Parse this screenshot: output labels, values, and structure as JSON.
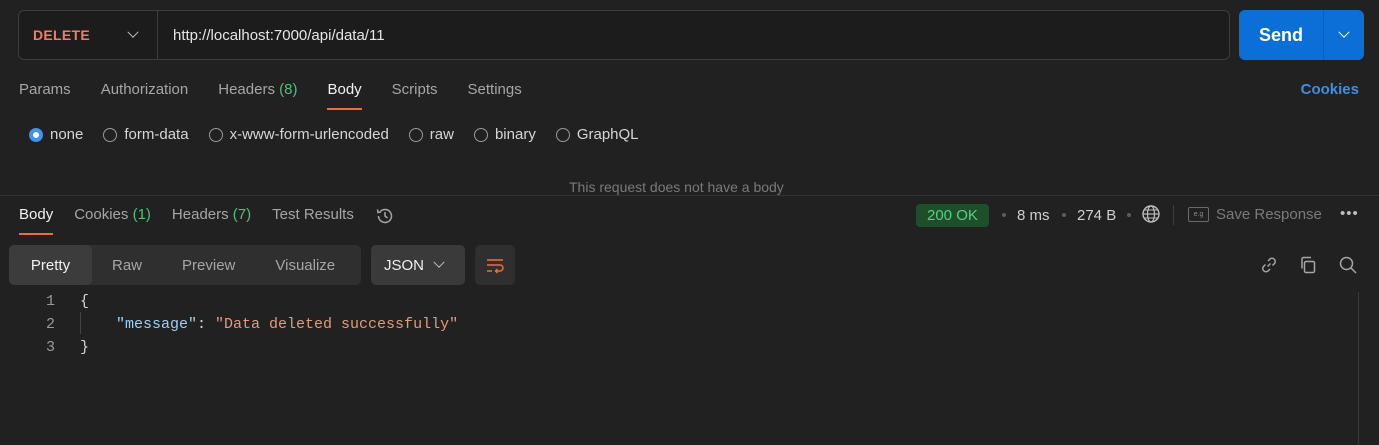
{
  "request": {
    "method": "DELETE",
    "url": "http://localhost:7000/api/data/11",
    "send_label": "Send"
  },
  "request_tabs": [
    {
      "label": "Params"
    },
    {
      "label": "Authorization"
    },
    {
      "label": "Headers",
      "count": "(8)"
    },
    {
      "label": "Body",
      "active": true
    },
    {
      "label": "Scripts"
    },
    {
      "label": "Settings"
    }
  ],
  "cookies_link": "Cookies",
  "body_options": [
    {
      "label": "none",
      "selected": true
    },
    {
      "label": "form-data"
    },
    {
      "label": "x-www-form-urlencoded"
    },
    {
      "label": "raw"
    },
    {
      "label": "binary"
    },
    {
      "label": "GraphQL"
    }
  ],
  "no_body_text": "This request does not have a body",
  "response_tabs": [
    {
      "label": "Body",
      "active": true
    },
    {
      "label": "Cookies",
      "count": "(1)"
    },
    {
      "label": "Headers",
      "count": "(7)"
    },
    {
      "label": "Test Results"
    }
  ],
  "response_meta": {
    "status": "200 OK",
    "time": "8 ms",
    "size": "274 B",
    "save_label": "Save Response",
    "save_icon_text": "e.g",
    "more": "•••"
  },
  "view_modes": [
    {
      "label": "Pretty",
      "active": true
    },
    {
      "label": "Raw"
    },
    {
      "label": "Preview"
    },
    {
      "label": "Visualize"
    }
  ],
  "format": "JSON",
  "code": {
    "line_numbers": [
      "1",
      "2",
      "3"
    ],
    "open_brace": "{",
    "key": "\"message\"",
    "colon": ": ",
    "value": "\"Data deleted successfully\"",
    "close_brace": "}"
  },
  "colors": {
    "accent": "#f26b3a",
    "send_button": "#0b6fd8",
    "method": "#f47b67",
    "status_ok": "#55d17f",
    "link": "#3d8fe6"
  },
  "icons": [
    "chevron-down-icon",
    "history-icon",
    "globe-icon",
    "save-response-icon",
    "more-icon",
    "wrap-lines-icon",
    "link-icon",
    "copy-icon",
    "search-icon"
  ]
}
